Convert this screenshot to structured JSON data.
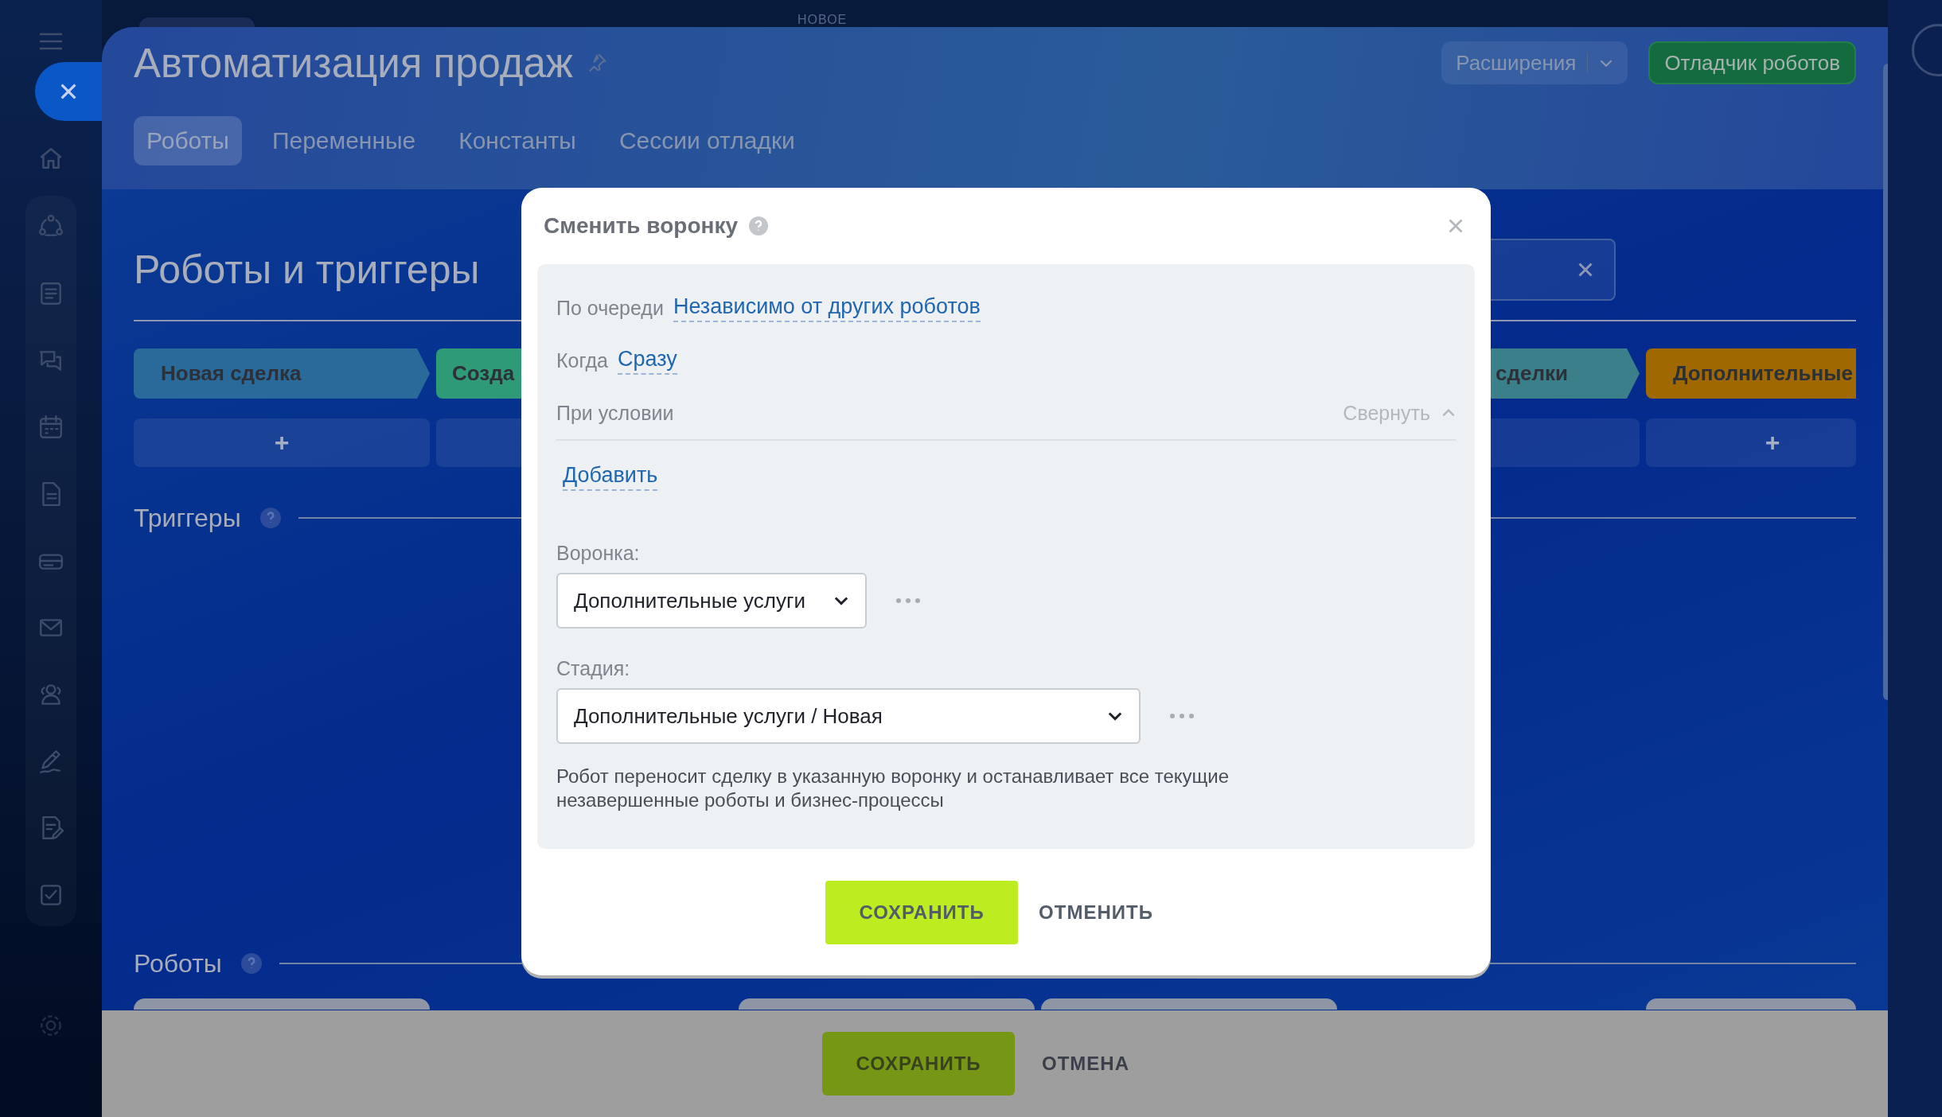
{
  "header": {
    "new_label": "НОВОЕ",
    "title": "Автоматизация продаж",
    "extensions_button": "Расширения",
    "debugger_button": "Отладчик роботов"
  },
  "tabs": [
    {
      "label": "Роботы",
      "selected": true
    },
    {
      "label": "Переменные",
      "selected": false
    },
    {
      "label": "Константы",
      "selected": false
    },
    {
      "label": "Сессии отладки",
      "selected": false
    }
  ],
  "section_title": "Роботы и триггеры",
  "stages": [
    {
      "label": "Новая сделка",
      "color": "#2a6a9a",
      "add_label": "+"
    },
    {
      "label": "Созда",
      "color": "#2f9a78"
    },
    {
      "label": "сделки",
      "color": "#3a7f8a"
    },
    {
      "label": "Дополнительные",
      "color": "#a06800",
      "add_label": "+"
    }
  ],
  "triggers_heading": "Триггеры",
  "robots_heading": "Роботы",
  "dialog": {
    "title": "Сменить воронку",
    "rows": [
      {
        "label": "По очереди",
        "value": "Независимо от других роботов"
      },
      {
        "label": "Когда",
        "value": "Сразу"
      }
    ],
    "condition": {
      "label": "При условии",
      "toggle": "Свернуть",
      "expanded": true,
      "add_link": "Добавить"
    },
    "fields": [
      {
        "label": "Воронка:",
        "value": "Дополнительные услуги"
      },
      {
        "label": "Стадия:",
        "value": "Дополнительные услуги / Новая"
      }
    ],
    "description": "Робот переносит сделку в указанную воронку и останавливает все текущие незавершенные роботы и бизнес-процессы",
    "save": "СОХРАНИТЬ",
    "cancel": "ОТМЕНИТЬ"
  },
  "footer": {
    "save": "СОХРАНИТЬ",
    "cancel": "ОТМЕНА"
  }
}
